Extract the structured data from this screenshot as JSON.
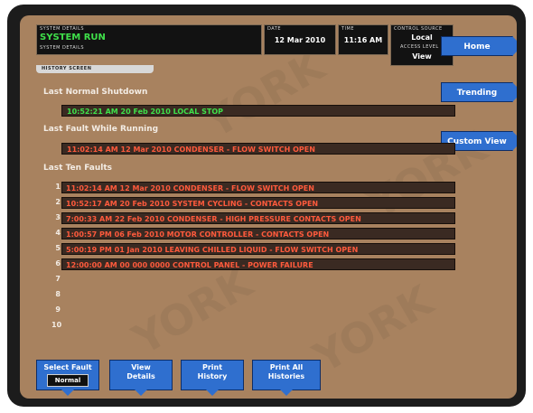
{
  "header": {
    "system_details_label": "SYSTEM DETAILS",
    "system_status": "SYSTEM RUN",
    "system_sub_label": "SYSTEM DETAILS",
    "date_label": "DATE",
    "date_value": "12 Mar 2010",
    "time_label": "TIME",
    "time_value": "11:16 AM",
    "control_source_label": "CONTROL SOURCE",
    "control_source_value": "Local",
    "access_level_label": "ACCESS LEVEL",
    "access_level_value": "View",
    "screen_tab": "HISTORY SCREEN"
  },
  "nav": {
    "home": "Home",
    "trending": "Trending",
    "custom_view": "Custom View"
  },
  "sections": {
    "last_normal_label": "Last Normal Shutdown",
    "last_normal_entry": "10:52:21 AM  20 Feb 2010  LOCAL STOP",
    "last_fault_label": "Last Fault While Running",
    "last_fault_entry": "11:02:14 AM  12 Mar 2010  CONDENSER - FLOW SWITCH OPEN",
    "last_ten_label": "Last Ten Faults"
  },
  "faults": [
    {
      "num": "1",
      "text": "11:02:14 AM  12 Mar 2010  CONDENSER - FLOW SWITCH OPEN"
    },
    {
      "num": "2",
      "text": "10:52:17 AM  20 Feb 2010  SYSTEM CYCLING - CONTACTS OPEN"
    },
    {
      "num": "3",
      "text": "7:00:33 AM  22 Feb 2010  CONDENSER - HIGH PRESSURE CONTACTS OPEN"
    },
    {
      "num": "4",
      "text": "1:00:57 PM  06 Feb 2010  MOTOR CONTROLLER - CONTACTS OPEN"
    },
    {
      "num": "5",
      "text": "5:00:19 PM  01 Jan 2010  LEAVING CHILLED LIQUID - FLOW SWITCH OPEN"
    },
    {
      "num": "6",
      "text": "12:00:00 AM  00 000 0000  CONTROL PANEL - POWER FAILURE"
    },
    {
      "num": "7",
      "text": ""
    },
    {
      "num": "8",
      "text": ""
    },
    {
      "num": "9",
      "text": ""
    },
    {
      "num": "10",
      "text": ""
    }
  ],
  "softkeys": {
    "select_fault_line1": "Select Fault",
    "select_fault_value": "Normal",
    "view_details_1": "View",
    "view_details_2": "Details",
    "print_history_1": "Print",
    "print_history_2": "History",
    "print_all_1": "Print All",
    "print_all_2": "Histories"
  },
  "watermark": "YORK",
  "colors": {
    "background": "#a8825f",
    "status_green": "#3fe04a",
    "normal_entry": "#3fe04a",
    "fault_text": "#ff5a3c",
    "button_blue": "#2f6fcf"
  }
}
